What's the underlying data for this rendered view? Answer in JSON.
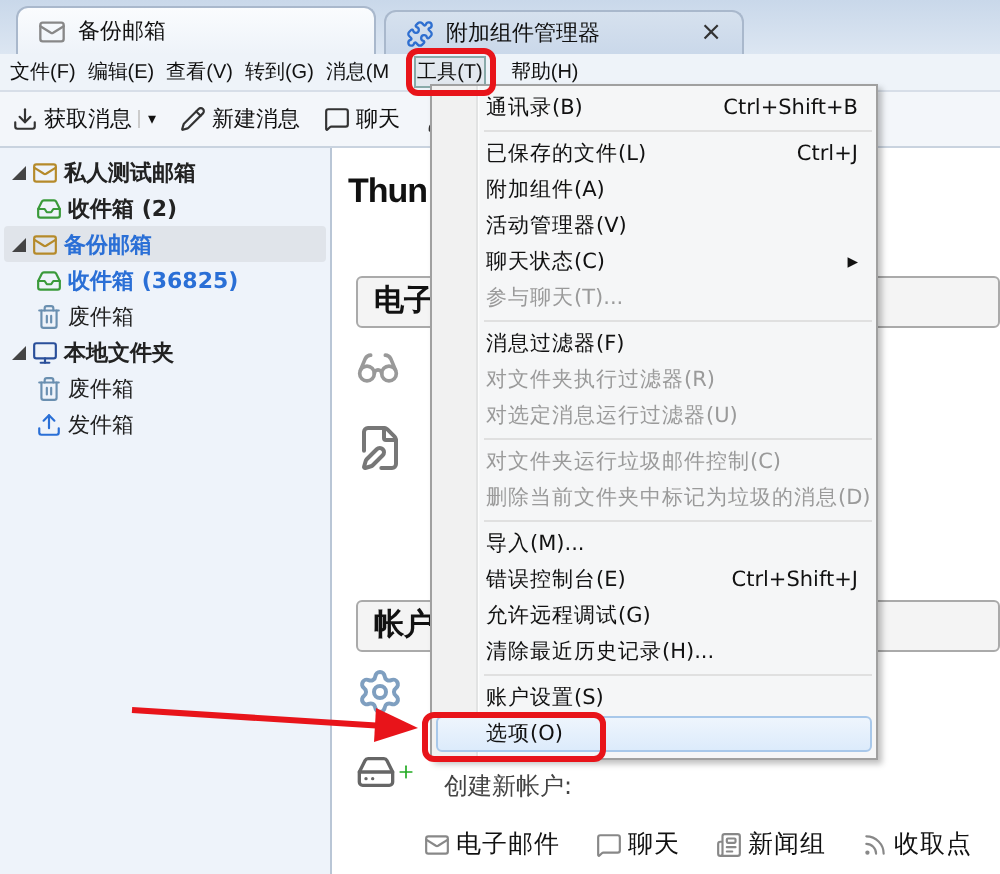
{
  "tabs": [
    {
      "label": "备份邮箱",
      "selected": true
    },
    {
      "label": "附加组件管理器",
      "selected": false,
      "close": "×"
    }
  ],
  "menubar": [
    {
      "label": "文件(F)",
      "selected": false
    },
    {
      "label": "编辑(E)",
      "selected": false
    },
    {
      "label": "查看(V)",
      "selected": false
    },
    {
      "label": "转到(G)",
      "selected": false
    },
    {
      "label": "消息(M",
      "selected": false
    },
    {
      "label": "工具(T)",
      "selected": true
    },
    {
      "label": "帮助(H)",
      "selected": false
    }
  ],
  "toolbar": [
    {
      "label": "获取消息",
      "caret": "▾"
    },
    {
      "label": "新建消息"
    },
    {
      "label": "聊天"
    }
  ],
  "folders": [
    {
      "label": "私人测试邮箱",
      "kind": "account",
      "selected": false,
      "expanded": true,
      "new": false,
      "children": [
        {
          "label": "收件箱 (2)",
          "kind": "inbox",
          "selected": false,
          "new": false
        }
      ]
    },
    {
      "label": "备份邮箱",
      "kind": "account",
      "selected": true,
      "expanded": true,
      "new": true,
      "children": [
        {
          "label": "收件箱 (36825)",
          "kind": "inbox",
          "selected": false,
          "new": true
        },
        {
          "label": "废件箱",
          "kind": "trash",
          "selected": false,
          "new": false
        }
      ]
    },
    {
      "label": "本地文件夹",
      "kind": "local",
      "selected": false,
      "expanded": true,
      "new": false,
      "children": [
        {
          "label": "废件箱",
          "kind": "trash",
          "selected": false,
          "new": false
        },
        {
          "label": "发件箱",
          "kind": "outbox",
          "selected": false,
          "new": false
        }
      ]
    }
  ],
  "content": {
    "heading": "Thun",
    "email_section": "电子",
    "account_section": "帐户",
    "create_account": "创建新帐户:",
    "links": [
      {
        "label": "电子邮件"
      },
      {
        "label": "聊天"
      },
      {
        "label": "新闻组"
      },
      {
        "label": "收取点"
      }
    ]
  },
  "tools_menu": [
    {
      "kind": "item",
      "label": "通讯录(B)",
      "shortcut": "Ctrl+Shift+B",
      "disabled": false,
      "selected": false
    },
    {
      "kind": "separator"
    },
    {
      "kind": "item",
      "label": "已保存的文件(L)",
      "shortcut": "Ctrl+J",
      "disabled": false,
      "selected": false
    },
    {
      "kind": "item",
      "label": "附加组件(A)",
      "disabled": false,
      "selected": false
    },
    {
      "kind": "item",
      "label": "活动管理器(V)",
      "disabled": false,
      "selected": false
    },
    {
      "kind": "submenu",
      "label": "聊天状态(C)",
      "arrow": "▸",
      "disabled": false,
      "selected": false
    },
    {
      "kind": "item",
      "label": "参与聊天(T)...",
      "disabled": true,
      "selected": false
    },
    {
      "kind": "separator"
    },
    {
      "kind": "item",
      "label": "消息过滤器(F)",
      "disabled": false,
      "selected": false
    },
    {
      "kind": "item",
      "label": "对文件夹执行过滤器(R)",
      "disabled": true,
      "selected": false
    },
    {
      "kind": "item",
      "label": "对选定消息运行过滤器(U)",
      "disabled": true,
      "selected": false
    },
    {
      "kind": "separator"
    },
    {
      "kind": "item",
      "label": "对文件夹运行垃圾邮件控制(C)",
      "disabled": true,
      "selected": false
    },
    {
      "kind": "item",
      "label": "删除当前文件夹中标记为垃圾的消息(D)",
      "disabled": true,
      "selected": false
    },
    {
      "kind": "separator"
    },
    {
      "kind": "item",
      "label": "导入(M)...",
      "disabled": false,
      "selected": false
    },
    {
      "kind": "item",
      "label": "错误控制台(E)",
      "shortcut": "Ctrl+Shift+J",
      "disabled": false,
      "selected": false
    },
    {
      "kind": "item",
      "label": "允许远程调试(G)",
      "disabled": false,
      "selected": false
    },
    {
      "kind": "item",
      "label": "清除最近历史记录(H)...",
      "disabled": false,
      "selected": false
    },
    {
      "kind": "separator"
    },
    {
      "kind": "item",
      "label": "账户设置(S)",
      "disabled": false,
      "selected": false
    },
    {
      "kind": "item",
      "label": "选项(O)",
      "disabled": false,
      "selected": true
    }
  ],
  "annotations": [
    {
      "kind": "box"
    },
    {
      "kind": "box"
    },
    {
      "kind": "arrow"
    }
  ]
}
